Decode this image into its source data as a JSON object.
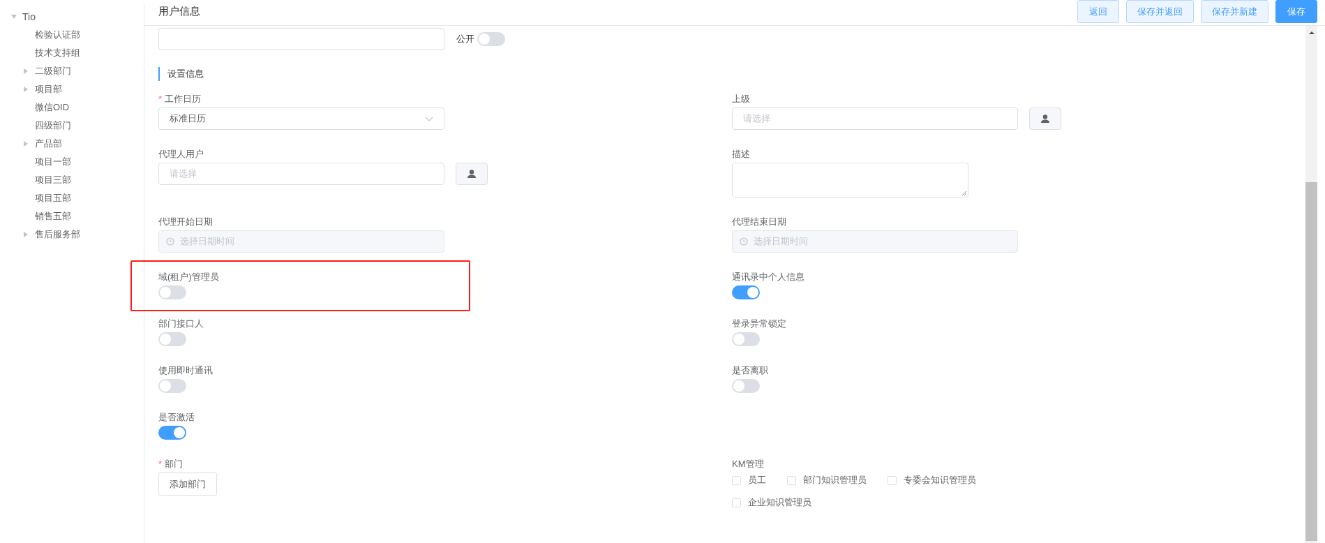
{
  "sidebar": {
    "tree": [
      {
        "label": "Tio",
        "expanded": true,
        "children": [
          {
            "label": "检验认证部"
          },
          {
            "label": "技术支持组"
          },
          {
            "label": "二级部门",
            "expanded": false
          },
          {
            "label": "项目部",
            "expanded": false
          },
          {
            "label": "微信OID"
          },
          {
            "label": "四级部门"
          },
          {
            "label": "产品部",
            "expanded": false
          },
          {
            "label": "项目一部"
          },
          {
            "label": "项目三部"
          },
          {
            "label": "项目五部"
          },
          {
            "label": "销售五部"
          },
          {
            "label": "售后服务部",
            "expanded": false
          }
        ]
      }
    ]
  },
  "header": {
    "title": "用户信息",
    "buttons": [
      {
        "label": "返回",
        "kind": "secondary"
      },
      {
        "label": "保存并返回",
        "kind": "secondary"
      },
      {
        "label": "保存并新建",
        "kind": "secondary"
      },
      {
        "label": "保存",
        "kind": "primary"
      }
    ]
  },
  "top_row": {
    "public_switch": {
      "label": "公开",
      "on": false
    }
  },
  "section": {
    "title": "设置信息"
  },
  "rows": [
    {
      "left": {
        "kind": "select",
        "label": "工作日历",
        "required_mark": "*",
        "value": "标准日历"
      },
      "right": {
        "kind": "picker",
        "label": "上级",
        "placeholder": "请选择"
      }
    },
    {
      "left": {
        "kind": "picker",
        "label": "代理人用户",
        "placeholder": "请选择"
      },
      "right": {
        "kind": "textarea",
        "label": "描述"
      }
    },
    {
      "left": {
        "kind": "datetime",
        "label": "代理开始日期",
        "placeholder": "选择日期时间",
        "disabled": true
      },
      "right": {
        "kind": "datetime",
        "label": "代理结束日期",
        "placeholder": "选择日期时间",
        "disabled": true
      }
    },
    {
      "left": {
        "kind": "switch",
        "label": "域(租户)管理员",
        "on": false,
        "highlighted": true
      },
      "right": {
        "kind": "switch",
        "label": "通讯录中个人信息",
        "on": true,
        "highlighted": false
      }
    },
    {
      "left": {
        "kind": "switch",
        "label": "部门接口人",
        "on": false,
        "highlighted": false
      },
      "right": {
        "kind": "switch",
        "label": "登录异常锁定",
        "on": false,
        "highlighted": false
      }
    },
    {
      "left": {
        "kind": "switch",
        "label": "使用即时通讯",
        "on": false,
        "highlighted": false
      },
      "right": {
        "kind": "switch",
        "label": "是否离职",
        "on": false,
        "highlighted": false
      }
    },
    {
      "left": {
        "kind": "switch",
        "label": "是否激活",
        "on": true,
        "highlighted": false
      }
    },
    {
      "left": {
        "kind": "button",
        "label": "部门",
        "required_mark": "*",
        "button": "添加部门"
      },
      "right": {
        "kind": "checkboxes",
        "label": "KM管理",
        "options": [
          {
            "label": "员工",
            "checked": false
          },
          {
            "label": "部门知识管理员",
            "checked": false
          },
          {
            "label": "专委会知识管理员",
            "checked": false
          },
          {
            "label": "企业知识管理员",
            "checked": false
          }
        ]
      }
    }
  ]
}
